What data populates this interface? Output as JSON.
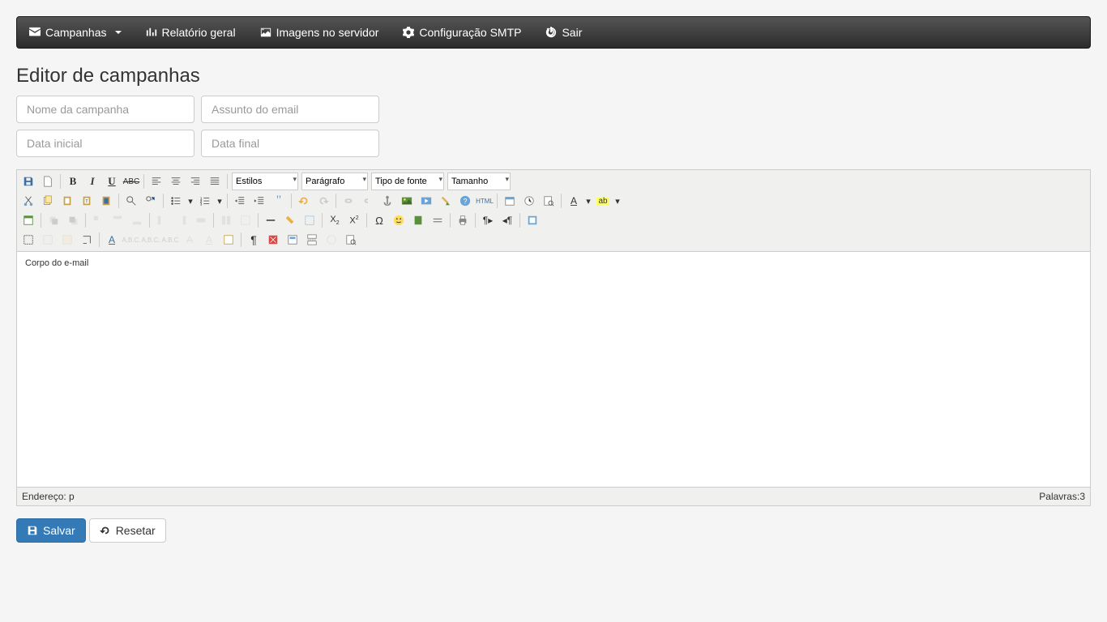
{
  "nav": {
    "campaigns": "Campanhas",
    "report": "Relatório geral",
    "images": "Imagens no servidor",
    "smtp": "Configuração SMTP",
    "logout": "Sair"
  },
  "page": {
    "title": "Editor de campanhas"
  },
  "form": {
    "name_placeholder": "Nome da campanha",
    "subject_placeholder": "Assunto do email",
    "date_start_placeholder": "Data inicial",
    "date_end_placeholder": "Data final"
  },
  "editor": {
    "styles_label": "Estilos",
    "paragraph_label": "Parágrafo",
    "font_label": "Tipo de fonte",
    "size_label": "Tamanho",
    "body_text": "Corpo do e-mail",
    "status_path_label": "Endereço:",
    "status_path_value": "p",
    "word_count_label": "Palavras:",
    "word_count_value": "3",
    "html_label": "HTML",
    "omega": "Ω",
    "t_symbol": "T"
  },
  "actions": {
    "save": "Salvar",
    "reset": "Resetar"
  },
  "colors": {
    "primary": "#337ab7",
    "navbar_bg": "#333333",
    "page_bg": "#f5f5f5"
  }
}
